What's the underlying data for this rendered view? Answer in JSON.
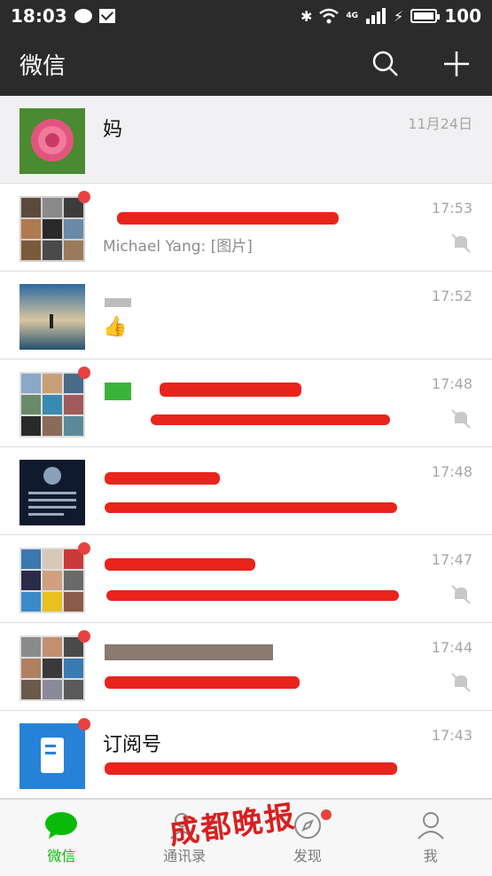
{
  "status_bar": {
    "time": "18:03",
    "battery": "100",
    "network": "4G"
  },
  "nav": {
    "title": "微信"
  },
  "chats": [
    {
      "name": "妈",
      "time": "11月24日",
      "preview": "",
      "pinned": true,
      "unread_dot": false,
      "muted": false
    },
    {
      "name": "",
      "time": "17:53",
      "preview": "Michael Yang: [图片]",
      "pinned": false,
      "unread_dot": true,
      "muted": true
    },
    {
      "name": "",
      "time": "17:52",
      "preview": "",
      "pinned": false,
      "unread_dot": false,
      "muted": false
    },
    {
      "name": "",
      "time": "17:48",
      "preview": "",
      "pinned": false,
      "unread_dot": true,
      "muted": true
    },
    {
      "name": "",
      "time": "17:48",
      "preview": "",
      "pinned": false,
      "unread_dot": false,
      "muted": false
    },
    {
      "name": "",
      "time": "17:47",
      "preview": "",
      "pinned": false,
      "unread_dot": true,
      "muted": true
    },
    {
      "name": "",
      "time": "17:44",
      "preview": "",
      "pinned": false,
      "unread_dot": true,
      "muted": true
    },
    {
      "name": "订阅号",
      "time": "17:43",
      "preview": "",
      "pinned": false,
      "unread_dot": true,
      "muted": false
    }
  ],
  "tabs": [
    {
      "label": "微信",
      "icon": "chat-bubble-icon",
      "active": true
    },
    {
      "label": "通讯录",
      "icon": "contacts-icon",
      "active": false
    },
    {
      "label": "发现",
      "icon": "compass-icon",
      "active": false
    },
    {
      "label": "我",
      "icon": "person-icon",
      "active": false
    }
  ],
  "watermark": "成都晚报",
  "colors": {
    "accent": "#09bb07",
    "header": "#2b2b2b",
    "badge": "#e64340"
  }
}
